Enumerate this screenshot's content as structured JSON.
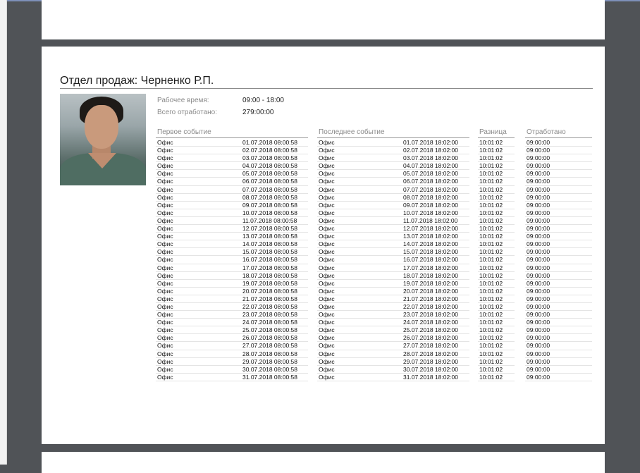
{
  "report": {
    "title": "Отдел продаж: Черненко Р.П.",
    "work_time_label": "Рабочее время:",
    "work_time_value": "09:00 - 18:00",
    "total_label": "Всего отработано:",
    "total_value": "279:00:00"
  },
  "table": {
    "headers": {
      "first_event": "Первое событие",
      "last_event": "Последнее событие",
      "difference": "Разница",
      "worked": "Отработано"
    },
    "rows": [
      [
        "Офис",
        "01.07.2018 08:00:58",
        "Офис",
        "01.07.2018 18:02:00",
        "10:01:02",
        "09:00:00"
      ],
      [
        "Офис",
        "02.07.2018 08:00:58",
        "Офис",
        "02.07.2018 18:02:00",
        "10:01:02",
        "09:00:00"
      ],
      [
        "Офис",
        "03.07.2018 08:00:58",
        "Офис",
        "03.07.2018 18:02:00",
        "10:01:02",
        "09:00:00"
      ],
      [
        "Офис",
        "04.07.2018 08:00:58",
        "Офис",
        "04.07.2018 18:02:00",
        "10:01:02",
        "09:00:00"
      ],
      [
        "Офис",
        "05.07.2018 08:00:58",
        "Офис",
        "05.07.2018 18:02:00",
        "10:01:02",
        "09:00:00"
      ],
      [
        "Офис",
        "06.07.2018 08:00:58",
        "Офис",
        "06.07.2018 18:02:00",
        "10:01:02",
        "09:00:00"
      ],
      [
        "Офис",
        "07.07.2018 08:00:58",
        "Офис",
        "07.07.2018 18:02:00",
        "10:01:02",
        "09:00:00"
      ],
      [
        "Офис",
        "08.07.2018 08:00:58",
        "Офис",
        "08.07.2018 18:02:00",
        "10:01:02",
        "09:00:00"
      ],
      [
        "Офис",
        "09.07.2018 08:00:58",
        "Офис",
        "09.07.2018 18:02:00",
        "10:01:02",
        "09:00:00"
      ],
      [
        "Офис",
        "10.07.2018 08:00:58",
        "Офис",
        "10.07.2018 18:02:00",
        "10:01:02",
        "09:00:00"
      ],
      [
        "Офис",
        "11.07.2018 08:00:58",
        "Офис",
        "11.07.2018 18:02:00",
        "10:01:02",
        "09:00:00"
      ],
      [
        "Офис",
        "12.07.2018 08:00:58",
        "Офис",
        "12.07.2018 18:02:00",
        "10:01:02",
        "09:00:00"
      ],
      [
        "Офис",
        "13.07.2018 08:00:58",
        "Офис",
        "13.07.2018 18:02:00",
        "10:01:02",
        "09:00:00"
      ],
      [
        "Офис",
        "14.07.2018 08:00:58",
        "Офис",
        "14.07.2018 18:02:00",
        "10:01:02",
        "09:00:00"
      ],
      [
        "Офис",
        "15.07.2018 08:00:58",
        "Офис",
        "15.07.2018 18:02:00",
        "10:01:02",
        "09:00:00"
      ],
      [
        "Офис",
        "16.07.2018 08:00:58",
        "Офис",
        "16.07.2018 18:02:00",
        "10:01:02",
        "09:00:00"
      ],
      [
        "Офис",
        "17.07.2018 08:00:58",
        "Офис",
        "17.07.2018 18:02:00",
        "10:01:02",
        "09:00:00"
      ],
      [
        "Офис",
        "18.07.2018 08:00:58",
        "Офис",
        "18.07.2018 18:02:00",
        "10:01:02",
        "09:00:00"
      ],
      [
        "Офис",
        "19.07.2018 08:00:58",
        "Офис",
        "19.07.2018 18:02:00",
        "10:01:02",
        "09:00:00"
      ],
      [
        "Офис",
        "20.07.2018 08:00:58",
        "Офис",
        "20.07.2018 18:02:00",
        "10:01:02",
        "09:00:00"
      ],
      [
        "Офис",
        "21.07.2018 08:00:58",
        "Офис",
        "21.07.2018 18:02:00",
        "10:01:02",
        "09:00:00"
      ],
      [
        "Офис",
        "22.07.2018 08:00:58",
        "Офис",
        "22.07.2018 18:02:00",
        "10:01:02",
        "09:00:00"
      ],
      [
        "Офис",
        "23.07.2018 08:00:58",
        "Офис",
        "23.07.2018 18:02:00",
        "10:01:02",
        "09:00:00"
      ],
      [
        "Офис",
        "24.07.2018 08:00:58",
        "Офис",
        "24.07.2018 18:02:00",
        "10:01:02",
        "09:00:00"
      ],
      [
        "Офис",
        "25.07.2018 08:00:58",
        "Офис",
        "25.07.2018 18:02:00",
        "10:01:02",
        "09:00:00"
      ],
      [
        "Офис",
        "26.07.2018 08:00:58",
        "Офис",
        "26.07.2018 18:02:00",
        "10:01:02",
        "09:00:00"
      ],
      [
        "Офис",
        "27.07.2018 08:00:58",
        "Офис",
        "27.07.2018 18:02:00",
        "10:01:02",
        "09:00:00"
      ],
      [
        "Офис",
        "28.07.2018 08:00:58",
        "Офис",
        "28.07.2018 18:02:00",
        "10:01:02",
        "09:00:00"
      ],
      [
        "Офис",
        "29.07.2018 08:00:58",
        "Офис",
        "29.07.2018 18:02:00",
        "10:01:02",
        "09:00:00"
      ],
      [
        "Офис",
        "30.07.2018 08:00:58",
        "Офис",
        "30.07.2018 18:02:00",
        "10:01:02",
        "09:00:00"
      ],
      [
        "Офис",
        "31.07.2018 08:00:58",
        "Офис",
        "31.07.2018 18:02:00",
        "10:01:02",
        "09:00:00"
      ]
    ]
  }
}
